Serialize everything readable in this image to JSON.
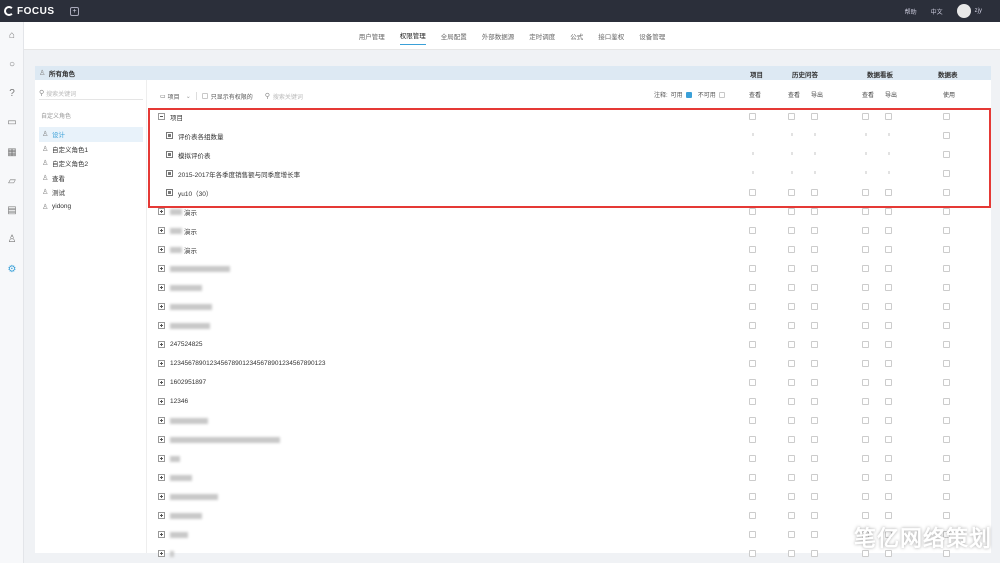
{
  "app": {
    "name": "FOCUS"
  },
  "topbar": {
    "help": "帮助",
    "lang": "中文",
    "user": "zjy"
  },
  "subnav": {
    "tabs": [
      "用户管理",
      "权限管理",
      "全局配置",
      "外部数据源",
      "定时调度",
      "公式",
      "接口鉴权",
      "设备管理"
    ],
    "active_index": 1
  },
  "panel": {
    "title": "所有角色",
    "columns": [
      "项目",
      "历史问答",
      "数据看板",
      "数据表"
    ],
    "subheads": {
      "view": "查看",
      "export": "导出",
      "use": "使用"
    }
  },
  "roles": {
    "search_placeholder": "搜索关键词",
    "group_label": "自定义角色",
    "items": [
      "设计",
      "自定义角色1",
      "自定义角色2",
      "查看",
      "测试",
      "yidong"
    ],
    "active_index": 0
  },
  "toolbar": {
    "folder_label": "项目",
    "only_permitted_label": "只显示有权限的",
    "search_placeholder": "搜索关键词",
    "legend_prefix": "注释:",
    "legend_available": "可用",
    "legend_unavailable": "不可用"
  },
  "tree": {
    "root_label": "项目",
    "children": [
      "评价表各组数量",
      "模拟评价表",
      "2015-2017年各季度销售额与同季度增长率",
      "yu10（30）"
    ],
    "projects": [
      "演示",
      "演示",
      "演示",
      "",
      "",
      "",
      "",
      "247524825",
      "1234567890123456789012345678901234567890123",
      "1602951897",
      "12346",
      "",
      "",
      "",
      "",
      "",
      "",
      "",
      ""
    ]
  },
  "watermark": "笔亿网络策划"
}
